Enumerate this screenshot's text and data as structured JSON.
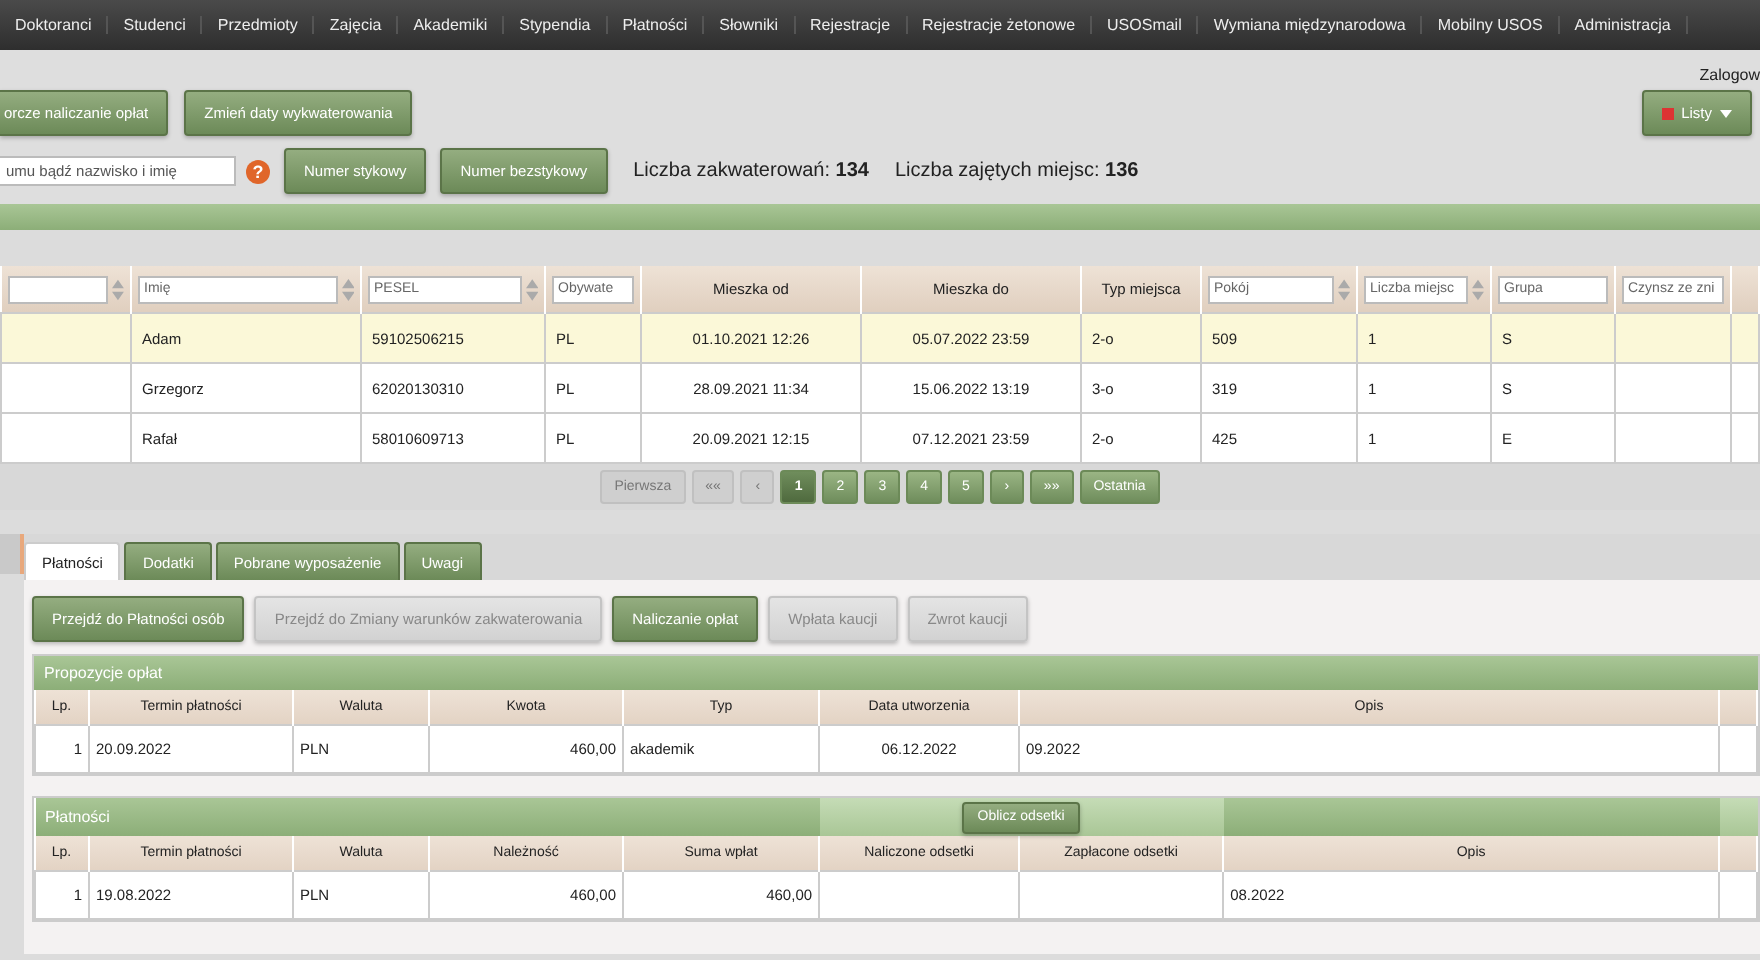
{
  "nav": [
    {
      "label": "Doktoranci"
    },
    {
      "label": "Studenci"
    },
    {
      "label": "Przedmioty"
    },
    {
      "label": "Zajęcia"
    },
    {
      "label": "Akademiki"
    },
    {
      "label": "Stypendia"
    },
    {
      "label": "Płatności"
    },
    {
      "label": "Słowniki"
    },
    {
      "label": "Rejestracje"
    },
    {
      "label": "Rejestracje żetonowe"
    },
    {
      "label": "USOSmail"
    },
    {
      "label": "Wymiana międzynarodowa"
    },
    {
      "label": "Mobilny USOS"
    },
    {
      "label": "Administracja"
    }
  ],
  "logged_in": "Zalogow",
  "actions": [
    "orcze naliczanie opłat",
    "Zmień daty wykwaterowania"
  ],
  "lists_button": "Listy",
  "search": {
    "placeholder": "umu bądź nazwisko i imię",
    "help": "?"
  },
  "search_buttons": [
    "Numer stykowy",
    "Numer bezstykowy"
  ],
  "stats": [
    {
      "label": "Liczba zakwaterowań:",
      "value": "134"
    },
    {
      "label": "Liczba zajętych miejsc:",
      "value": "136"
    }
  ],
  "table": {
    "columns": [
      {
        "kind": "filter",
        "sortable": true
      },
      {
        "kind": "filter",
        "placeholder": "Imię",
        "sortable": true
      },
      {
        "kind": "filter",
        "placeholder": "PESEL",
        "sortable": true
      },
      {
        "kind": "filter",
        "placeholder": "Obywate",
        "sortable": false
      },
      {
        "kind": "label",
        "label": "Mieszka od"
      },
      {
        "kind": "label",
        "label": "Mieszka do"
      },
      {
        "kind": "label",
        "label": "Typ miejsca"
      },
      {
        "kind": "filter",
        "placeholder": "Pokój",
        "sortable": true
      },
      {
        "kind": "filter",
        "placeholder": "Liczba miejsc",
        "sortable": true
      },
      {
        "kind": "filter",
        "placeholder": "Grupa",
        "sortable": false
      },
      {
        "kind": "filter",
        "placeholder": "Czynsz ze zni",
        "sortable": false
      }
    ],
    "rows": [
      {
        "selected": true,
        "cells": [
          "",
          "Adam",
          "59102506215",
          "PL",
          "01.10.2021 12:26",
          "05.07.2022 23:59",
          "2-o",
          "509",
          "1",
          "S",
          ""
        ]
      },
      {
        "selected": false,
        "cells": [
          "",
          "Grzegorz",
          "62020130310",
          "PL",
          "28.09.2021 11:34",
          "15.06.2022 13:19",
          "3-o",
          "319",
          "1",
          "S",
          ""
        ]
      },
      {
        "selected": false,
        "cells": [
          "",
          "Rafał",
          "58010609713",
          "PL",
          "20.09.2021 12:15",
          "07.12.2021 23:59",
          "2-o",
          "425",
          "1",
          "E",
          ""
        ]
      }
    ]
  },
  "pagination": [
    {
      "label": "Pierwsza",
      "disabled": true,
      "selected": false
    },
    {
      "label": "««",
      "disabled": true,
      "selected": false
    },
    {
      "label": "‹",
      "disabled": true,
      "selected": false
    },
    {
      "label": "1",
      "disabled": false,
      "selected": true
    },
    {
      "label": "2",
      "disabled": false,
      "selected": false
    },
    {
      "label": "3",
      "disabled": false,
      "selected": false
    },
    {
      "label": "4",
      "disabled": false,
      "selected": false
    },
    {
      "label": "5",
      "disabled": false,
      "selected": false
    },
    {
      "label": "›",
      "disabled": false,
      "selected": false
    },
    {
      "label": "»»",
      "disabled": false,
      "selected": false
    },
    {
      "label": "Ostatnia",
      "disabled": false,
      "selected": false
    }
  ],
  "tabs": [
    {
      "label": "Płatności",
      "selected": true
    },
    {
      "label": "Dodatki",
      "selected": false
    },
    {
      "label": "Pobrane wyposażenie",
      "selected": false
    },
    {
      "label": "Uwagi",
      "selected": false
    }
  ],
  "panel_buttons": [
    {
      "label": "Przejdź do Płatności osób",
      "disabled": false
    },
    {
      "label": "Przejdź do Zmiany warunków zakwaterowania",
      "disabled": true
    },
    {
      "label": "Naliczanie opłat",
      "disabled": false
    },
    {
      "label": "Wpłata kaucji",
      "disabled": true
    },
    {
      "label": "Zwrot kaucji",
      "disabled": true
    }
  ],
  "proposals": {
    "title": "Propozycje opłat",
    "columns": [
      "Lp.",
      "Termin płatności",
      "Waluta",
      "Kwota",
      "Typ",
      "Data utworzenia",
      "Opis"
    ],
    "rows": [
      [
        "1",
        "20.09.2022",
        "PLN",
        "460,00",
        "akademik",
        "06.12.2022",
        "09.2022"
      ]
    ]
  },
  "payments": {
    "title": "Płatności",
    "action": "Oblicz odsetki",
    "columns": [
      "Lp.",
      "Termin płatności",
      "Waluta",
      "Należność",
      "Suma wpłat",
      "Naliczone odsetki",
      "Zapłacone odsetki",
      "Opis"
    ],
    "rows": [
      [
        "1",
        "19.08.2022",
        "PLN",
        "460,00",
        "460,00",
        "",
        "",
        "08.2022"
      ]
    ]
  }
}
